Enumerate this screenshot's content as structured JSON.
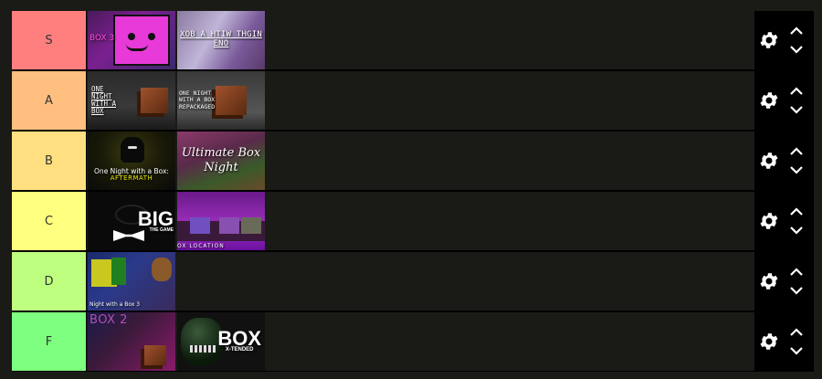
{
  "tiers": [
    {
      "label": "S",
      "color": "#ff7f7f",
      "items": [
        {
          "id": "t-box3",
          "name": "box3-thumb",
          "text": "BOX 3"
        },
        {
          "id": "t-xob",
          "name": "one-night-with-a-box-reversed-thumb",
          "text": "XOB A HTIW THGIN ENO"
        }
      ]
    },
    {
      "label": "A",
      "color": "#ffbf7f",
      "items": [
        {
          "id": "t-onwab",
          "name": "one-night-with-a-box-thumb",
          "text": "ONE NIGHT WITH A BOX"
        },
        {
          "id": "t-onwabr",
          "name": "one-night-with-a-box-repackaged-thumb",
          "text": "ONE NIGHT WITH A BOX REPACKAGED"
        }
      ]
    },
    {
      "label": "B",
      "color": "#ffdf7f",
      "items": [
        {
          "id": "t-after",
          "name": "aftermath-thumb",
          "text": "One Night with a Box:",
          "sub": "AFTERMATH"
        },
        {
          "id": "t-ultimate",
          "name": "ultimate-box-night-thumb",
          "text": "Ultimate Box Night"
        }
      ]
    },
    {
      "label": "C",
      "color": "#ffff7f",
      "items": [
        {
          "id": "t-big",
          "name": "big-the-game-thumb",
          "text": "BIG",
          "sub": "THE GAME"
        },
        {
          "id": "t-location",
          "name": "box-location-thumb",
          "text": "OX  LOCATION"
        }
      ]
    },
    {
      "label": "D",
      "color": "#bfff7f",
      "items": [
        {
          "id": "t-box3b",
          "name": "one-night-with-a-box-3-thumb",
          "text": "Night with a Box 3"
        }
      ]
    },
    {
      "label": "F",
      "color": "#7fff7f",
      "items": [
        {
          "id": "t-box2",
          "name": "box2-thumb",
          "text": "BOX 2"
        },
        {
          "id": "t-xtended",
          "name": "box-x-tended-thumb",
          "text": "BOX",
          "sub": "X-TENDED"
        }
      ]
    }
  ]
}
